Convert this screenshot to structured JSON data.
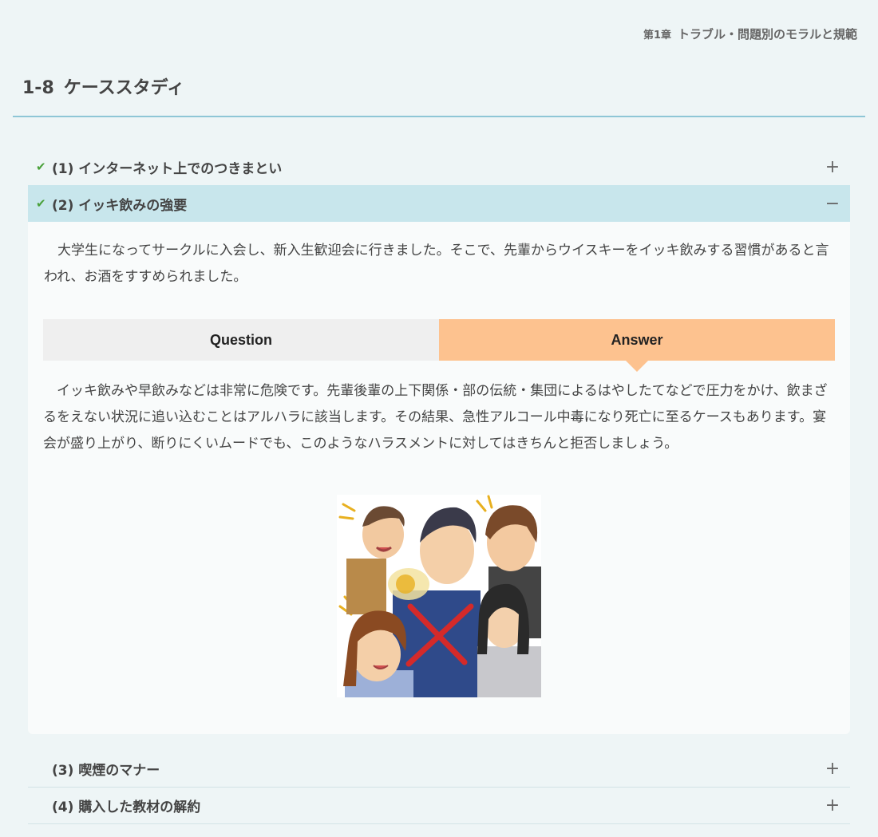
{
  "header": {
    "chapter_num": "第1章",
    "chapter_title": "トラブル・問題別のモラルと規範",
    "section_num": "1-8",
    "section_title": "ケーススタディ"
  },
  "items": [
    {
      "label": "(1) インターネット上でのつきまとい",
      "checked": true,
      "toggle": "+"
    },
    {
      "label": "(2) イッキ飲みの強要",
      "checked": true,
      "toggle": "−"
    },
    {
      "label": "(3) 喫煙のマナー",
      "checked": false,
      "toggle": "+"
    },
    {
      "label": "(4) 購入した教材の解約",
      "checked": false,
      "toggle": "+"
    }
  ],
  "case": {
    "question_text": "大学生になってサークルに入会し、新入生歓迎会に行きました。そこで、先輩からウイスキーをイッキ飲みする習慣があると言われ、お酒をすすめられました。",
    "tab_question": "Question",
    "tab_answer": "Answer",
    "answer_text": "イッキ飲みや早飲みなどは非常に危険です。先輩後輩の上下関係・部の伝統・集団によるはやしたてなどで圧力をかけ、飲まざるをえない状況に追い込むことはアルハラに該当します。その結果、急性アルコール中毒になり死亡に至るケースもあります。宴会が盛り上がり、断りにくいムードでも、このようなハラスメントに対してはきちんと拒否しましょう。"
  },
  "colors": {
    "open_header_bg": "#c8e6ec",
    "answer_tab_bg": "#fdc28f",
    "check": "#4aa13a",
    "rule": "#8ec6d6"
  }
}
